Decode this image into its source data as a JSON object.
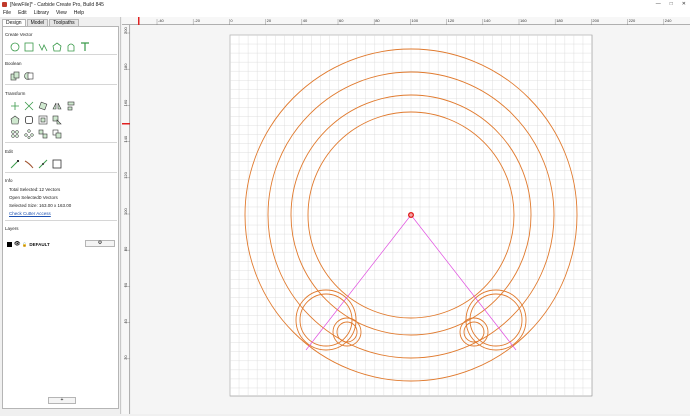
{
  "window": {
    "title": "[NewFile]* - Carbide Create Pro, Build 845",
    "buttons": [
      "—",
      "□",
      "✕"
    ]
  },
  "menu": [
    "File",
    "Edit",
    "Library",
    "View",
    "Help"
  ],
  "tabs": [
    {
      "label": "Design",
      "active": true
    },
    {
      "label": "Model",
      "active": false
    },
    {
      "label": "Toolpaths",
      "active": false
    }
  ],
  "sections": {
    "create_vector": "Create Vector",
    "boolean": "Boolean",
    "transform": "Transform",
    "edit": "Edit",
    "info": "Info",
    "layers": "Layers"
  },
  "icons": {
    "create_vector": [
      "circle-icon",
      "rectangle-icon",
      "polyline-icon",
      "polygon-icon",
      "curve-icon",
      "text-icon"
    ],
    "boolean": [
      "boolean-union-icon",
      "boolean-subtract-icon"
    ],
    "transform_row1": [
      "move-icon",
      "scale-icon",
      "rotate-icon",
      "mirror-icon",
      "align-icon"
    ],
    "transform_row2": [
      "offset-icon",
      "fillet-icon",
      "inset-icon",
      "group-icon"
    ],
    "transform_row3": [
      "array-icon",
      "circular-array-icon",
      "join-icon",
      "duplicate-icon"
    ],
    "edit": [
      "node-edit-icon",
      "trim-icon",
      "smooth-icon",
      "bounding-box-icon"
    ]
  },
  "info": {
    "total_label": "Total Selected:",
    "total_value": "12 Vectors",
    "open_label": "Open Selected:",
    "open_value": "0 Vectors",
    "size_label": "Selected Size:",
    "size_value": "163.00 x 163.00",
    "check_link": "Check Cutter Access"
  },
  "layers": [
    {
      "name": "DEFAULT",
      "color": "#000000"
    }
  ],
  "layer_gear": "⚙",
  "add_layer": "+",
  "ruler": {
    "top_labels": [
      "-40",
      "-20",
      "0",
      "20",
      "40",
      "60",
      "80",
      "100",
      "120",
      "140",
      "160",
      "180",
      "200",
      "220",
      "240"
    ],
    "left_labels": [
      "200",
      "180",
      "160",
      "140",
      "120",
      "100",
      "80",
      "60",
      "40",
      "20"
    ]
  },
  "colors": {
    "accent": "#e07a2e",
    "icon_green": "#3a9a4a",
    "guide": "#e050e0",
    "origin_red": "#e02020"
  }
}
